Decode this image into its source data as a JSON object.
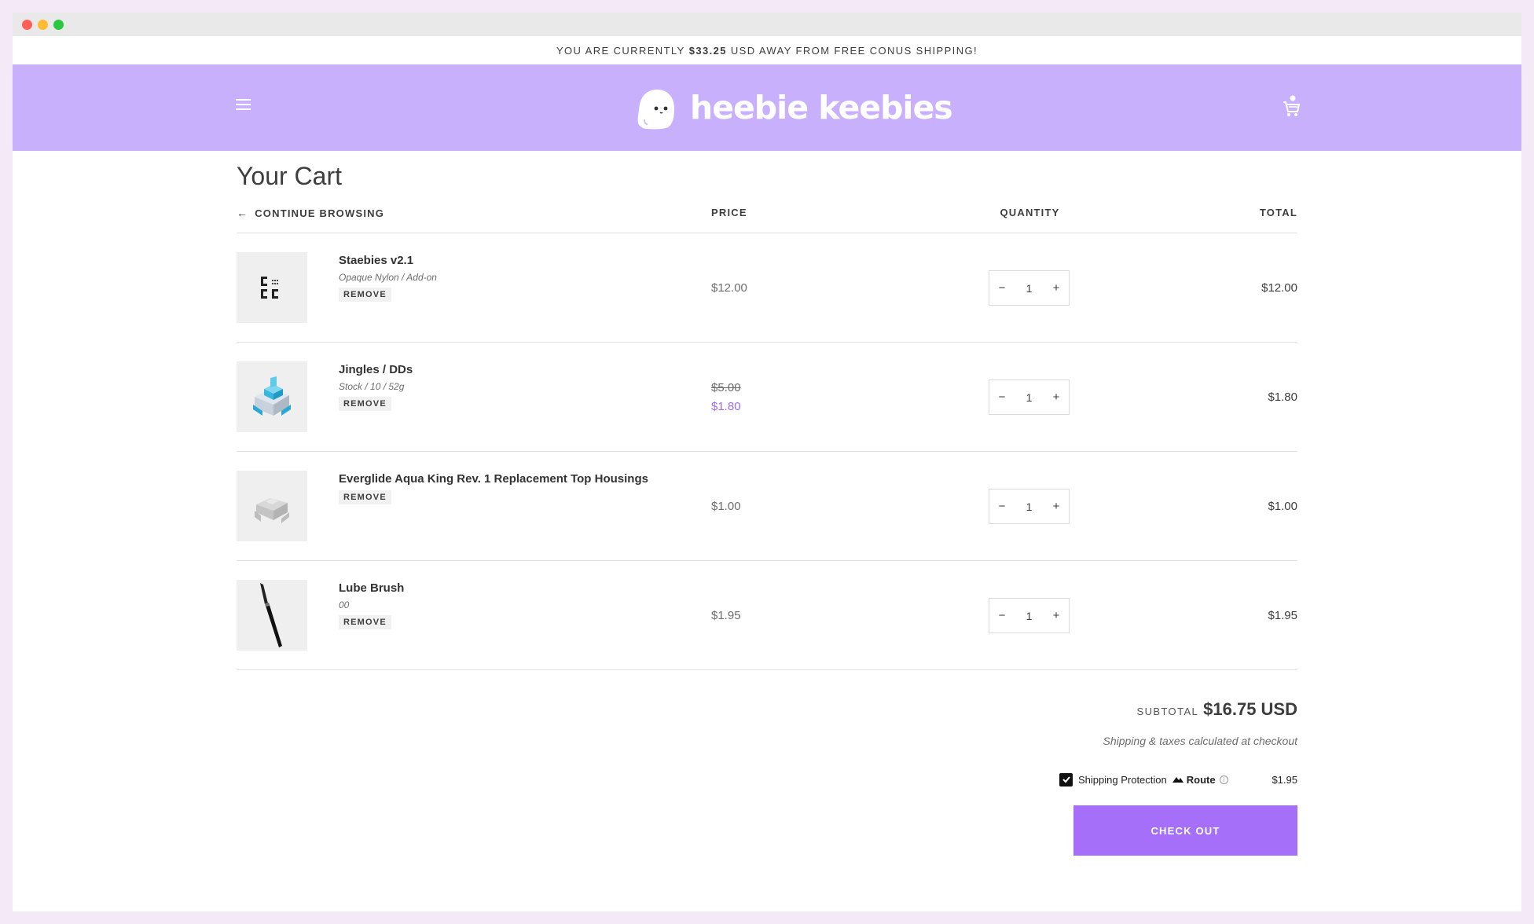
{
  "announcement": {
    "prefix": "YOU ARE CURRENTLY",
    "amount": "$33.25",
    "suffix": "USD AWAY FROM FREE CONUS SHIPPING!"
  },
  "header": {
    "brand": "heebie keebies",
    "menu_icon": "hamburger-menu-icon",
    "cart_icon": "shopping-cart-icon",
    "background": "#c8b0fd"
  },
  "cart": {
    "title": "Your Cart",
    "continue_label": "CONTINUE BROWSING",
    "columns": {
      "price": "PRICE",
      "quantity": "QUANTITY",
      "total": "TOTAL"
    },
    "items": [
      {
        "name": "Staebies v2.1",
        "variant": "Opaque Nylon / Add-on",
        "remove": "REMOVE",
        "price": "$12.00",
        "original_price": null,
        "quantity": "1",
        "total": "$12.00",
        "image_icon": "stabilizer-icon"
      },
      {
        "name": "Jingles / DDs",
        "variant": "Stock / 10 / 52g",
        "remove": "REMOVE",
        "price": "$1.80",
        "original_price": "$5.00",
        "quantity": "1",
        "total": "$1.80",
        "image_icon": "switch-icon"
      },
      {
        "name": "Everglide Aqua King Rev. 1 Replacement Top Housings",
        "variant": null,
        "remove": "REMOVE",
        "price": "$1.00",
        "original_price": null,
        "quantity": "1",
        "total": "$1.00",
        "image_icon": "housing-icon"
      },
      {
        "name": "Lube Brush",
        "variant": "00",
        "remove": "REMOVE",
        "price": "$1.95",
        "original_price": null,
        "quantity": "1",
        "total": "$1.95",
        "image_icon": "brush-icon"
      }
    ],
    "qty_minus": "−",
    "qty_plus": "+"
  },
  "summary": {
    "subtotal_label": "SUBTOTAL",
    "subtotal_amount": "$16.75 USD",
    "shipping_note": "Shipping & taxes calculated at checkout",
    "protection_label": "Shipping Protection",
    "protection_brand": "Route",
    "protection_price": "$1.95",
    "protection_checked": true,
    "checkout_label": "CHECK OUT"
  },
  "colors": {
    "accent": "#a66ffa",
    "sale": "#9b6cf9",
    "page_bg": "#f4e9f6"
  }
}
